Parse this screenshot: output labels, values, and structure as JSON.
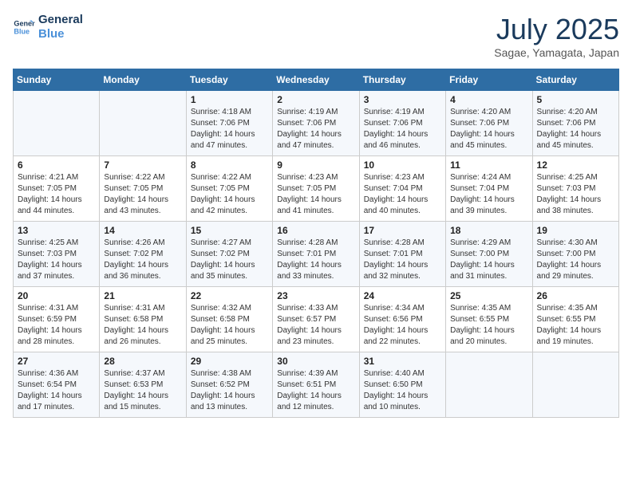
{
  "logo": {
    "line1": "General",
    "line2": "Blue"
  },
  "title": "July 2025",
  "location": "Sagae, Yamagata, Japan",
  "days_header": [
    "Sunday",
    "Monday",
    "Tuesday",
    "Wednesday",
    "Thursday",
    "Friday",
    "Saturday"
  ],
  "weeks": [
    [
      {
        "day": "",
        "info": ""
      },
      {
        "day": "",
        "info": ""
      },
      {
        "day": "1",
        "info": "Sunrise: 4:18 AM\nSunset: 7:06 PM\nDaylight: 14 hours and 47 minutes."
      },
      {
        "day": "2",
        "info": "Sunrise: 4:19 AM\nSunset: 7:06 PM\nDaylight: 14 hours and 47 minutes."
      },
      {
        "day": "3",
        "info": "Sunrise: 4:19 AM\nSunset: 7:06 PM\nDaylight: 14 hours and 46 minutes."
      },
      {
        "day": "4",
        "info": "Sunrise: 4:20 AM\nSunset: 7:06 PM\nDaylight: 14 hours and 45 minutes."
      },
      {
        "day": "5",
        "info": "Sunrise: 4:20 AM\nSunset: 7:06 PM\nDaylight: 14 hours and 45 minutes."
      }
    ],
    [
      {
        "day": "6",
        "info": "Sunrise: 4:21 AM\nSunset: 7:05 PM\nDaylight: 14 hours and 44 minutes."
      },
      {
        "day": "7",
        "info": "Sunrise: 4:22 AM\nSunset: 7:05 PM\nDaylight: 14 hours and 43 minutes."
      },
      {
        "day": "8",
        "info": "Sunrise: 4:22 AM\nSunset: 7:05 PM\nDaylight: 14 hours and 42 minutes."
      },
      {
        "day": "9",
        "info": "Sunrise: 4:23 AM\nSunset: 7:05 PM\nDaylight: 14 hours and 41 minutes."
      },
      {
        "day": "10",
        "info": "Sunrise: 4:23 AM\nSunset: 7:04 PM\nDaylight: 14 hours and 40 minutes."
      },
      {
        "day": "11",
        "info": "Sunrise: 4:24 AM\nSunset: 7:04 PM\nDaylight: 14 hours and 39 minutes."
      },
      {
        "day": "12",
        "info": "Sunrise: 4:25 AM\nSunset: 7:03 PM\nDaylight: 14 hours and 38 minutes."
      }
    ],
    [
      {
        "day": "13",
        "info": "Sunrise: 4:25 AM\nSunset: 7:03 PM\nDaylight: 14 hours and 37 minutes."
      },
      {
        "day": "14",
        "info": "Sunrise: 4:26 AM\nSunset: 7:02 PM\nDaylight: 14 hours and 36 minutes."
      },
      {
        "day": "15",
        "info": "Sunrise: 4:27 AM\nSunset: 7:02 PM\nDaylight: 14 hours and 35 minutes."
      },
      {
        "day": "16",
        "info": "Sunrise: 4:28 AM\nSunset: 7:01 PM\nDaylight: 14 hours and 33 minutes."
      },
      {
        "day": "17",
        "info": "Sunrise: 4:28 AM\nSunset: 7:01 PM\nDaylight: 14 hours and 32 minutes."
      },
      {
        "day": "18",
        "info": "Sunrise: 4:29 AM\nSunset: 7:00 PM\nDaylight: 14 hours and 31 minutes."
      },
      {
        "day": "19",
        "info": "Sunrise: 4:30 AM\nSunset: 7:00 PM\nDaylight: 14 hours and 29 minutes."
      }
    ],
    [
      {
        "day": "20",
        "info": "Sunrise: 4:31 AM\nSunset: 6:59 PM\nDaylight: 14 hours and 28 minutes."
      },
      {
        "day": "21",
        "info": "Sunrise: 4:31 AM\nSunset: 6:58 PM\nDaylight: 14 hours and 26 minutes."
      },
      {
        "day": "22",
        "info": "Sunrise: 4:32 AM\nSunset: 6:58 PM\nDaylight: 14 hours and 25 minutes."
      },
      {
        "day": "23",
        "info": "Sunrise: 4:33 AM\nSunset: 6:57 PM\nDaylight: 14 hours and 23 minutes."
      },
      {
        "day": "24",
        "info": "Sunrise: 4:34 AM\nSunset: 6:56 PM\nDaylight: 14 hours and 22 minutes."
      },
      {
        "day": "25",
        "info": "Sunrise: 4:35 AM\nSunset: 6:55 PM\nDaylight: 14 hours and 20 minutes."
      },
      {
        "day": "26",
        "info": "Sunrise: 4:35 AM\nSunset: 6:55 PM\nDaylight: 14 hours and 19 minutes."
      }
    ],
    [
      {
        "day": "27",
        "info": "Sunrise: 4:36 AM\nSunset: 6:54 PM\nDaylight: 14 hours and 17 minutes."
      },
      {
        "day": "28",
        "info": "Sunrise: 4:37 AM\nSunset: 6:53 PM\nDaylight: 14 hours and 15 minutes."
      },
      {
        "day": "29",
        "info": "Sunrise: 4:38 AM\nSunset: 6:52 PM\nDaylight: 14 hours and 13 minutes."
      },
      {
        "day": "30",
        "info": "Sunrise: 4:39 AM\nSunset: 6:51 PM\nDaylight: 14 hours and 12 minutes."
      },
      {
        "day": "31",
        "info": "Sunrise: 4:40 AM\nSunset: 6:50 PM\nDaylight: 14 hours and 10 minutes."
      },
      {
        "day": "",
        "info": ""
      },
      {
        "day": "",
        "info": ""
      }
    ]
  ]
}
